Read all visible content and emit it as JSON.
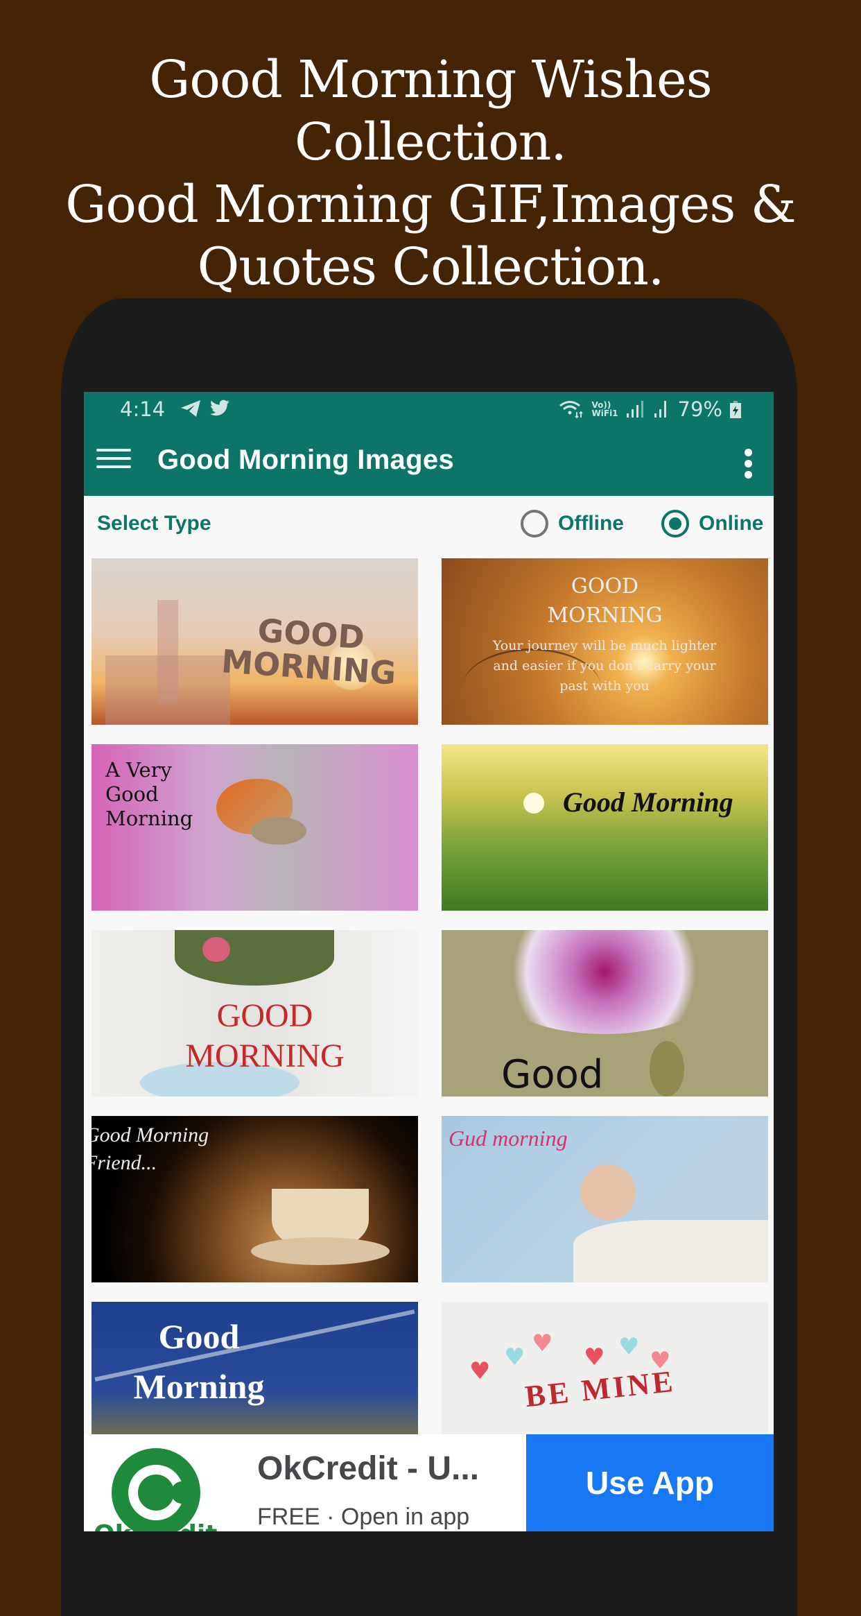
{
  "promo": {
    "lines": [
      "Good Morning Wishes",
      "Collection.",
      "Good Morning GIF,Images &",
      "Quotes Collection."
    ]
  },
  "status_bar": {
    "time": "4:14",
    "left_icons": [
      "telegram-icon",
      "twitter-icon"
    ],
    "right_icons": [
      "wifi-icon",
      "vowifi-icon",
      "signal-icon",
      "signal-icon"
    ],
    "vowifi_top": "Vo))",
    "vowifi_bottom": "WiFi1",
    "battery": "79%"
  },
  "app_bar": {
    "title": "Good Morning Images",
    "menu_icon": "hamburger-menu-icon",
    "more_icon": "more-vertical-icon"
  },
  "type_selector": {
    "label": "Select Type",
    "options": [
      {
        "label": "Offline",
        "checked": false
      },
      {
        "label": "Online",
        "checked": true
      }
    ]
  },
  "images": [
    {
      "caption": "GOOD MORNING",
      "description": "rainy window city skyline at sunrise"
    },
    {
      "caption": "GOOD MORNING",
      "quote": "Your journey will be much lighter and easier if you don't carry your past with you",
      "description": "tree silhouette at sunset"
    },
    {
      "caption": "A Very Good Morning",
      "description": "orange bird on pink flower branch"
    },
    {
      "caption": "Good Morning",
      "description": "wheat field at sunrise"
    },
    {
      "caption": "GOOD MORNING",
      "description": "flower vase and teacup"
    },
    {
      "caption": "Good",
      "description": "purple orchid"
    },
    {
      "caption": "Good Morning Friend...",
      "description": "steaming coffee cup with beans"
    },
    {
      "caption": "Gud morning",
      "description": "stretching baby on blue blanket"
    },
    {
      "caption": "Good Morning",
      "description": "blue sky with contrails at sunrise"
    },
    {
      "caption": "BE MINE",
      "description": "paper hearts on white"
    }
  ],
  "ad": {
    "brand_logo": "okcredit-logo-icon",
    "brand_text": "OkCredit",
    "title": "OkCredit - U...",
    "subtitle": "FREE · Open in app",
    "cta": "Use App"
  },
  "colors": {
    "background": "#442405",
    "primary": "#0c7568",
    "ad_button": "#1877f2",
    "ad_logo": "#1e8a3c"
  }
}
